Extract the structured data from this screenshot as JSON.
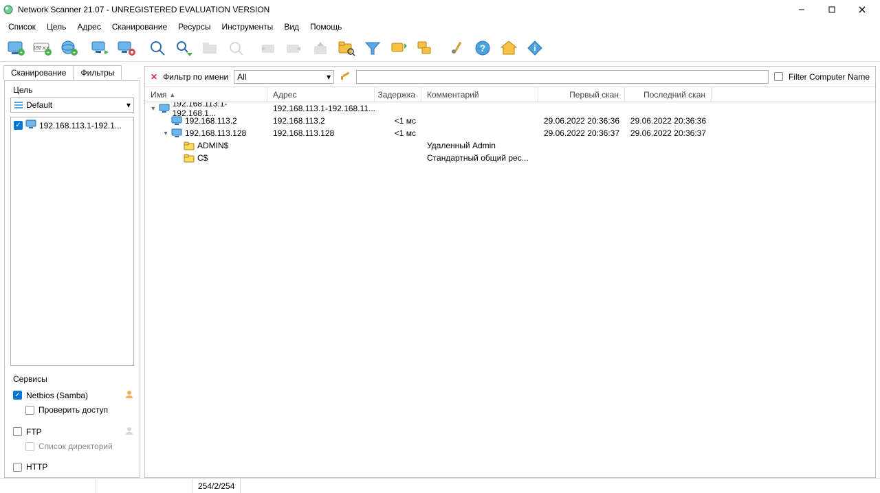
{
  "window": {
    "title": "Network Scanner 21.07 - UNREGISTERED EVALUATION VERSION"
  },
  "menu": [
    "Список",
    "Цель",
    "Адрес",
    "Сканирование",
    "Ресурсы",
    "Инструменты",
    "Вид",
    "Помощь"
  ],
  "left": {
    "tab_scan": "Сканирование",
    "tab_filters": "Фильтры",
    "target_label": "Цель",
    "target_selected": "Default",
    "target_item": "192.168.113.1-192.1...",
    "services_label": "Сервисы",
    "svc_netbios": "Netbios (Samba)",
    "svc_check_access": "Проверить доступ",
    "svc_ftp": "FTP",
    "svc_dirlist": "Список директорий",
    "svc_http": "HTTP"
  },
  "filter": {
    "label": "Фильтр по имени",
    "combo": "All",
    "cb_label": "Filter Computer Name"
  },
  "columns": {
    "name": "Имя",
    "addr": "Адрес",
    "lat": "Задержка",
    "comm": "Комментарий",
    "first": "Первый скан",
    "last": "Последний скан"
  },
  "rows": [
    {
      "indent": 0,
      "toggle": "▾",
      "icon": "pc",
      "name": "192.168.113.1-192.168.1...",
      "addr": "192.168.113.1-192.168.11...",
      "lat": "",
      "comm": "",
      "first": "",
      "last": ""
    },
    {
      "indent": 1,
      "toggle": "",
      "icon": "pc",
      "name": "192.168.113.2",
      "addr": "192.168.113.2",
      "lat": "<1 мс",
      "comm": "",
      "first": "29.06.2022 20:36:36",
      "last": "29.06.2022 20:36:36"
    },
    {
      "indent": 1,
      "toggle": "▾",
      "icon": "pc",
      "name": "192.168.113.128",
      "addr": "192.168.113.128",
      "lat": "<1 мс",
      "comm": "",
      "first": "29.06.2022 20:36:37",
      "last": "29.06.2022 20:36:37"
    },
    {
      "indent": 2,
      "toggle": "",
      "icon": "folder",
      "name": "ADMIN$",
      "addr": "",
      "lat": "",
      "comm": "Удаленный Admin",
      "first": "",
      "last": ""
    },
    {
      "indent": 2,
      "toggle": "",
      "icon": "folder",
      "name": "C$",
      "addr": "",
      "lat": "",
      "comm": "Стандартный общий рес...",
      "first": "",
      "last": ""
    }
  ],
  "status": {
    "counts": "254/2/254"
  }
}
